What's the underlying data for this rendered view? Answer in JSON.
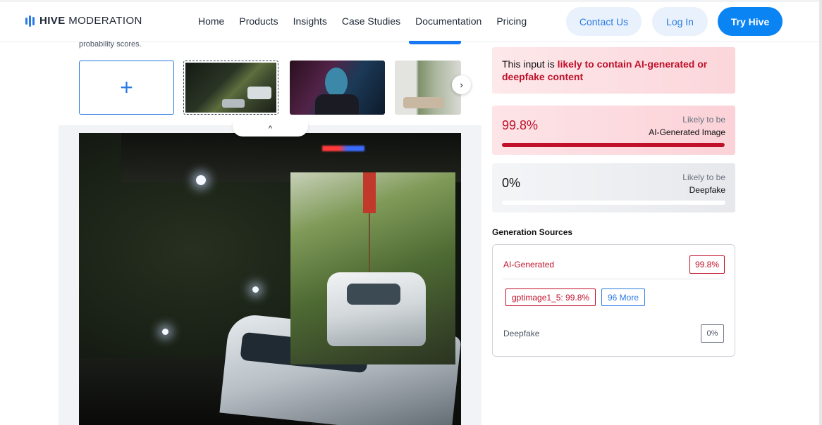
{
  "header": {
    "brand_bold": "HIVE",
    "brand_rest": "MODERATION",
    "nav": [
      "Home",
      "Products",
      "Insights",
      "Case Studies",
      "Documentation",
      "Pricing"
    ],
    "contact_label": "Contact Us",
    "login_label": "Log In",
    "try_label": "Try Hive"
  },
  "left": {
    "probability_text": "probability scores.",
    "add_symbol": "+",
    "next_arrow": "›",
    "collapse_arrow": "^"
  },
  "result": {
    "message_prefix": "This input is ",
    "message_highlight": "likely to contain AI-generated or deepfake content",
    "ai": {
      "value": "99.8%",
      "label_top": "Likely to be",
      "label_bottom": "AI-Generated Image",
      "fill_percent": 99.8
    },
    "deepfake": {
      "value": "0%",
      "label_top": "Likely to be",
      "label_bottom": "Deepfake",
      "fill_percent": 0
    }
  },
  "sources": {
    "title": "Generation Sources",
    "ai_label": "AI-Generated",
    "ai_score": "99.8%",
    "model_chip": "gptimage1_5: 99.8%",
    "more_chip": "96 More",
    "deepfake_label": "Deepfake",
    "deepfake_score": "0%"
  },
  "colors": {
    "accent_blue": "#2b7be4",
    "primary_button": "#0b84f3",
    "danger_red": "#c0102a"
  },
  "icons": [
    "hive-logo-icon",
    "plus-icon",
    "chevron-right-icon",
    "chevron-up-icon"
  ]
}
